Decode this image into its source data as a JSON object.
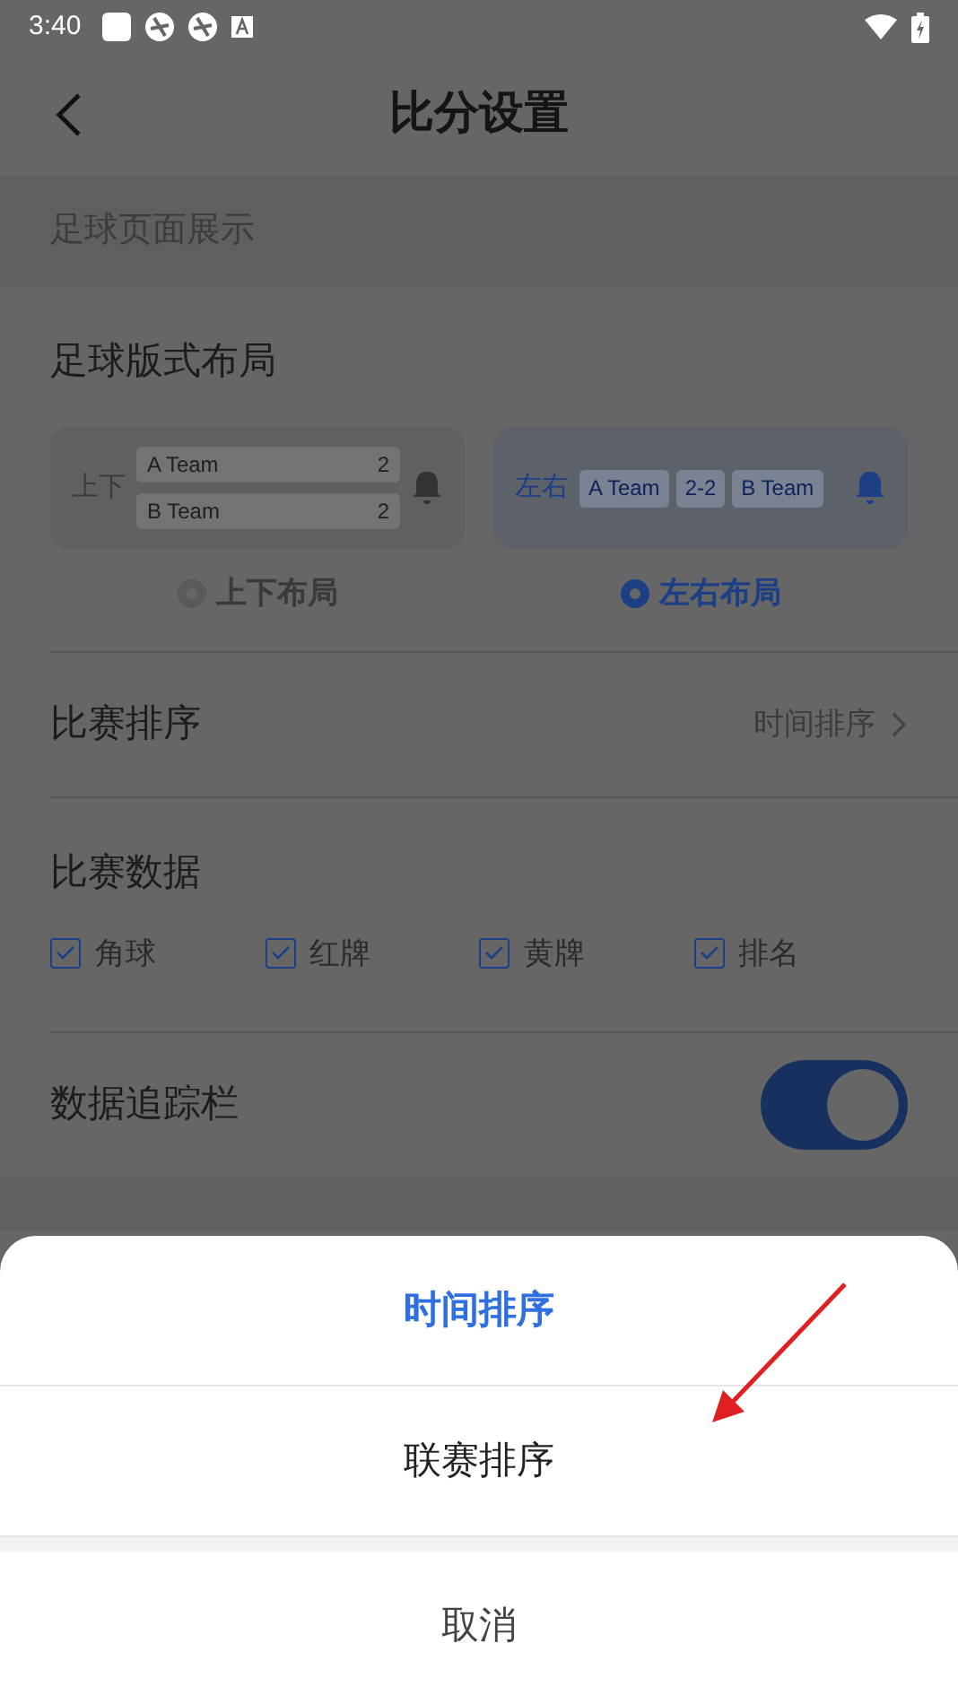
{
  "status_bar": {
    "time": "3:40"
  },
  "header": {
    "title": "比分设置"
  },
  "section_header": "足球页面展示",
  "layout_setting": {
    "label": "足球版式布局",
    "options": [
      {
        "kind": "stacked",
        "tag": "上下",
        "teams": [
          {
            "name": "A Team",
            "score": "2"
          },
          {
            "name": "B Team",
            "score": "2"
          }
        ],
        "label": "上下布局",
        "selected": false
      },
      {
        "kind": "inline",
        "tag": "左右",
        "chips": [
          "A Team",
          "2-2",
          "B Team"
        ],
        "label": "左右布局",
        "selected": true
      }
    ]
  },
  "sort_row": {
    "label": "比赛排序",
    "value": "时间排序"
  },
  "match_data": {
    "label": "比赛数据",
    "options": [
      {
        "label": "角球",
        "checked": true
      },
      {
        "label": "红牌",
        "checked": true
      },
      {
        "label": "黄牌",
        "checked": true
      },
      {
        "label": "排名",
        "checked": true
      }
    ]
  },
  "tracker": {
    "label": "数据追踪栏",
    "on": true
  },
  "action_sheet": {
    "options": [
      {
        "label": "时间排序",
        "selected": true
      },
      {
        "label": "联赛排序",
        "selected": false
      }
    ],
    "cancel": "取消"
  }
}
